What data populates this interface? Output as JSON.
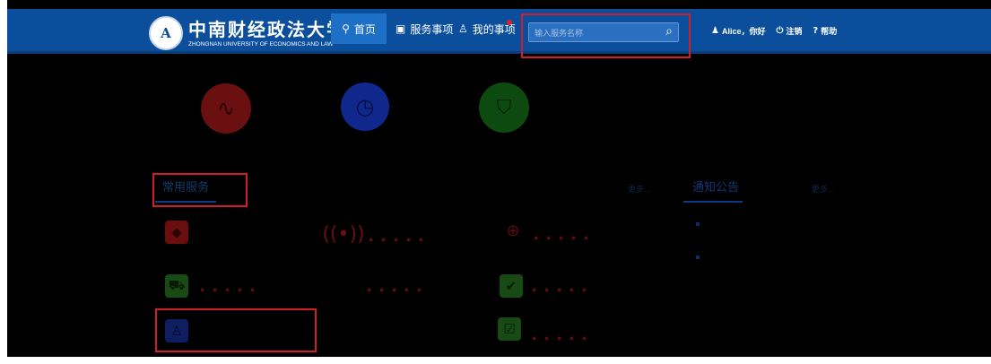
{
  "header": {
    "logo_text_cn": "中南财经政法大学",
    "logo_text_en": "ZHONGNAN UNIVERSITY OF ECONOMICS AND LAW",
    "nav": [
      {
        "label": "首页",
        "icon": "lightbulb-icon",
        "glyph": "💡",
        "active": true
      },
      {
        "label": "服务事项",
        "icon": "calendar-icon",
        "glyph": "▣"
      },
      {
        "label": "我的事项",
        "icon": "user-icon",
        "glyph": "♙"
      }
    ],
    "search_placeholder": "输入服务名称",
    "user_greeting": "Alice，你好",
    "logout_label": "注销",
    "help_label": "帮助",
    "nav_bg": "#0b4f9c",
    "active_bg": "#1d70c6"
  },
  "sections": {
    "common_services_title": "常用服务",
    "notices_title": "通知公告",
    "more_label": "更多..."
  },
  "rating_dots": "● ● ● ● ●",
  "highlight_color": "#d01f2a"
}
